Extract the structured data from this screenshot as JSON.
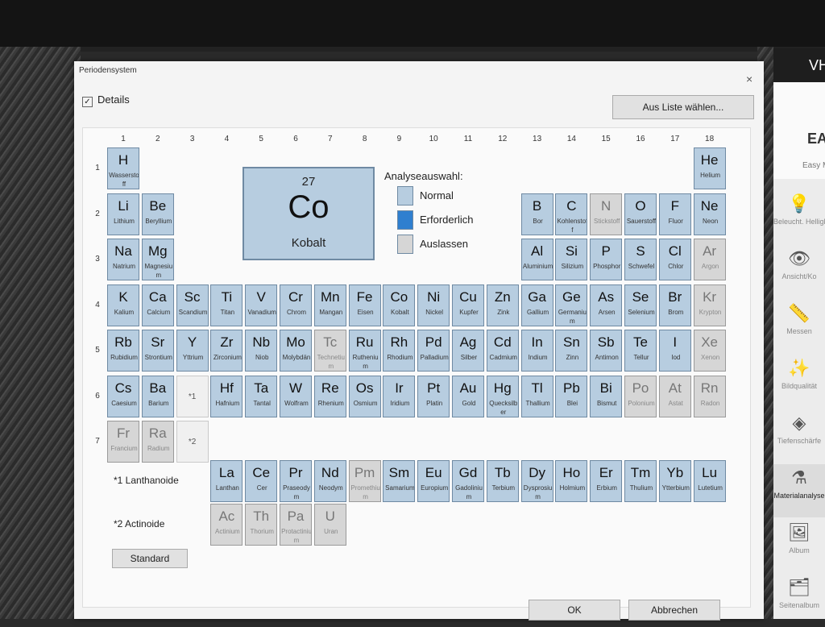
{
  "colors": {
    "normal": "#b7cde0",
    "required": "#2f7fcf",
    "skip": "#d6d6d6"
  },
  "app": {
    "header_text": "VH",
    "brand": "EAS",
    "brand_sub": "Easy M",
    "sidebar": [
      {
        "name": "beleuchtung",
        "icon": "bulb-icon",
        "glyph": "💡",
        "label": "Beleucht. Helligk.",
        "active": false
      },
      {
        "name": "ansicht",
        "icon": "view-icon",
        "glyph": "👁",
        "label": "Ansicht/Ko",
        "active": false
      },
      {
        "name": "messen",
        "icon": "ruler-icon",
        "glyph": "📏",
        "label": "Messen",
        "active": false
      },
      {
        "name": "bildqualitaet",
        "icon": "wand-icon",
        "glyph": "✨",
        "label": "Bildqualität",
        "active": false
      },
      {
        "name": "tiefenschaerfe",
        "icon": "layers-icon",
        "glyph": "◈",
        "label": "Tiefenschärfe",
        "active": false
      },
      {
        "name": "materialanalyse",
        "icon": "flask-icon",
        "glyph": "⚗",
        "label": "Materialanalyse",
        "active": true
      },
      {
        "name": "album",
        "icon": "album-icon",
        "glyph": "🖼",
        "label": "Album",
        "active": false
      },
      {
        "name": "seitenalbum",
        "icon": "page-album-icon",
        "glyph": "🗂",
        "label": "Seitenalbum",
        "active": false
      }
    ]
  },
  "dialog": {
    "title": "Periodensystem",
    "close": "×",
    "details_label": "Details",
    "details_checked": "✓",
    "choose_from_list": "Aus Liste wählen...",
    "standard": "Standard",
    "ok": "OK",
    "cancel": "Abbrechen"
  },
  "selected": {
    "number": "27",
    "symbol": "Co",
    "name": "Kobalt"
  },
  "legend": {
    "title": "Analyseauswahl:",
    "items": [
      {
        "label": "Normal",
        "state": "normal"
      },
      {
        "label": "Erforderlich",
        "state": "required"
      },
      {
        "label": "Auslassen",
        "state": "skip"
      }
    ]
  },
  "groups": [
    "1",
    "2",
    "3",
    "4",
    "5",
    "6",
    "7",
    "8",
    "9",
    "10",
    "11",
    "12",
    "13",
    "14",
    "15",
    "16",
    "17",
    "18"
  ],
  "periods": [
    "1",
    "2",
    "3",
    "4",
    "5",
    "6",
    "7"
  ],
  "placeholders": [
    {
      "text": "*1",
      "col": 3,
      "row": 6
    },
    {
      "text": "*2",
      "col": 3,
      "row": 7
    }
  ],
  "series_labels": {
    "lanthanides": "*1 Lanthanoide",
    "actinides": "*2 Actinoide"
  },
  "elements": [
    {
      "s": "H",
      "n": "Wasserstoff",
      "c": 1,
      "r": 1,
      "st": "normal"
    },
    {
      "s": "He",
      "n": "Helium",
      "c": 18,
      "r": 1,
      "st": "normal"
    },
    {
      "s": "Li",
      "n": "Lithium",
      "c": 1,
      "r": 2,
      "st": "normal"
    },
    {
      "s": "Be",
      "n": "Beryllium",
      "c": 2,
      "r": 2,
      "st": "normal"
    },
    {
      "s": "B",
      "n": "Bor",
      "c": 13,
      "r": 2,
      "st": "normal"
    },
    {
      "s": "C",
      "n": "Kohlenstoff",
      "c": 14,
      "r": 2,
      "st": "normal"
    },
    {
      "s": "N",
      "n": "Stickstoff",
      "c": 15,
      "r": 2,
      "st": "skip"
    },
    {
      "s": "O",
      "n": "Sauerstoff",
      "c": 16,
      "r": 2,
      "st": "normal"
    },
    {
      "s": "F",
      "n": "Fluor",
      "c": 17,
      "r": 2,
      "st": "normal"
    },
    {
      "s": "Ne",
      "n": "Neon",
      "c": 18,
      "r": 2,
      "st": "normal"
    },
    {
      "s": "Na",
      "n": "Natrium",
      "c": 1,
      "r": 3,
      "st": "normal"
    },
    {
      "s": "Mg",
      "n": "Magnesium",
      "c": 2,
      "r": 3,
      "st": "normal"
    },
    {
      "s": "Al",
      "n": "Aluminium",
      "c": 13,
      "r": 3,
      "st": "normal"
    },
    {
      "s": "Si",
      "n": "Silizium",
      "c": 14,
      "r": 3,
      "st": "normal"
    },
    {
      "s": "P",
      "n": "Phosphor",
      "c": 15,
      "r": 3,
      "st": "normal"
    },
    {
      "s": "S",
      "n": "Schwefel",
      "c": 16,
      "r": 3,
      "st": "normal"
    },
    {
      "s": "Cl",
      "n": "Chlor",
      "c": 17,
      "r": 3,
      "st": "normal"
    },
    {
      "s": "Ar",
      "n": "Argon",
      "c": 18,
      "r": 3,
      "st": "skip"
    },
    {
      "s": "K",
      "n": "Kalium",
      "c": 1,
      "r": 4,
      "st": "normal"
    },
    {
      "s": "Ca",
      "n": "Calcium",
      "c": 2,
      "r": 4,
      "st": "normal"
    },
    {
      "s": "Sc",
      "n": "Scandium",
      "c": 3,
      "r": 4,
      "st": "normal"
    },
    {
      "s": "Ti",
      "n": "Titan",
      "c": 4,
      "r": 4,
      "st": "normal"
    },
    {
      "s": "V",
      "n": "Vanadium",
      "c": 5,
      "r": 4,
      "st": "normal"
    },
    {
      "s": "Cr",
      "n": "Chrom",
      "c": 6,
      "r": 4,
      "st": "normal"
    },
    {
      "s": "Mn",
      "n": "Mangan",
      "c": 7,
      "r": 4,
      "st": "normal"
    },
    {
      "s": "Fe",
      "n": "Eisen",
      "c": 8,
      "r": 4,
      "st": "normal"
    },
    {
      "s": "Co",
      "n": "Kobalt",
      "c": 9,
      "r": 4,
      "st": "normal"
    },
    {
      "s": "Ni",
      "n": "Nickel",
      "c": 10,
      "r": 4,
      "st": "normal"
    },
    {
      "s": "Cu",
      "n": "Kupfer",
      "c": 11,
      "r": 4,
      "st": "normal"
    },
    {
      "s": "Zn",
      "n": "Zink",
      "c": 12,
      "r": 4,
      "st": "normal"
    },
    {
      "s": "Ga",
      "n": "Gallium",
      "c": 13,
      "r": 4,
      "st": "normal"
    },
    {
      "s": "Ge",
      "n": "Germanium",
      "c": 14,
      "r": 4,
      "st": "normal"
    },
    {
      "s": "As",
      "n": "Arsen",
      "c": 15,
      "r": 4,
      "st": "normal"
    },
    {
      "s": "Se",
      "n": "Selenium",
      "c": 16,
      "r": 4,
      "st": "normal"
    },
    {
      "s": "Br",
      "n": "Brom",
      "c": 17,
      "r": 4,
      "st": "normal"
    },
    {
      "s": "Kr",
      "n": "Krypton",
      "c": 18,
      "r": 4,
      "st": "skip"
    },
    {
      "s": "Rb",
      "n": "Rubidium",
      "c": 1,
      "r": 5,
      "st": "normal"
    },
    {
      "s": "Sr",
      "n": "Strontium",
      "c": 2,
      "r": 5,
      "st": "normal"
    },
    {
      "s": "Y",
      "n": "Yttrium",
      "c": 3,
      "r": 5,
      "st": "normal"
    },
    {
      "s": "Zr",
      "n": "Zirconium",
      "c": 4,
      "r": 5,
      "st": "normal"
    },
    {
      "s": "Nb",
      "n": "Niob",
      "c": 5,
      "r": 5,
      "st": "normal"
    },
    {
      "s": "Mo",
      "n": "Molybdän",
      "c": 6,
      "r": 5,
      "st": "normal"
    },
    {
      "s": "Tc",
      "n": "Technetium",
      "c": 7,
      "r": 5,
      "st": "skip"
    },
    {
      "s": "Ru",
      "n": "Ruthenium",
      "c": 8,
      "r": 5,
      "st": "normal"
    },
    {
      "s": "Rh",
      "n": "Rhodium",
      "c": 9,
      "r": 5,
      "st": "normal"
    },
    {
      "s": "Pd",
      "n": "Palladium",
      "c": 10,
      "r": 5,
      "st": "normal"
    },
    {
      "s": "Ag",
      "n": "Silber",
      "c": 11,
      "r": 5,
      "st": "normal"
    },
    {
      "s": "Cd",
      "n": "Cadmium",
      "c": 12,
      "r": 5,
      "st": "normal"
    },
    {
      "s": "In",
      "n": "Indium",
      "c": 13,
      "r": 5,
      "st": "normal"
    },
    {
      "s": "Sn",
      "n": "Zinn",
      "c": 14,
      "r": 5,
      "st": "normal"
    },
    {
      "s": "Sb",
      "n": "Antimon",
      "c": 15,
      "r": 5,
      "st": "normal"
    },
    {
      "s": "Te",
      "n": "Tellur",
      "c": 16,
      "r": 5,
      "st": "normal"
    },
    {
      "s": "I",
      "n": "Iod",
      "c": 17,
      "r": 5,
      "st": "normal"
    },
    {
      "s": "Xe",
      "n": "Xenon",
      "c": 18,
      "r": 5,
      "st": "skip"
    },
    {
      "s": "Cs",
      "n": "Caesium",
      "c": 1,
      "r": 6,
      "st": "normal"
    },
    {
      "s": "Ba",
      "n": "Barium",
      "c": 2,
      "r": 6,
      "st": "normal"
    },
    {
      "s": "Hf",
      "n": "Hafnium",
      "c": 4,
      "r": 6,
      "st": "normal"
    },
    {
      "s": "Ta",
      "n": "Tantal",
      "c": 5,
      "r": 6,
      "st": "normal"
    },
    {
      "s": "W",
      "n": "Wolfram",
      "c": 6,
      "r": 6,
      "st": "normal"
    },
    {
      "s": "Re",
      "n": "Rhenium",
      "c": 7,
      "r": 6,
      "st": "normal"
    },
    {
      "s": "Os",
      "n": "Osmium",
      "c": 8,
      "r": 6,
      "st": "normal"
    },
    {
      "s": "Ir",
      "n": "Iridium",
      "c": 9,
      "r": 6,
      "st": "normal"
    },
    {
      "s": "Pt",
      "n": "Platin",
      "c": 10,
      "r": 6,
      "st": "normal"
    },
    {
      "s": "Au",
      "n": "Gold",
      "c": 11,
      "r": 6,
      "st": "normal"
    },
    {
      "s": "Hg",
      "n": "Quecksilber",
      "c": 12,
      "r": 6,
      "st": "normal"
    },
    {
      "s": "Tl",
      "n": "Thallium",
      "c": 13,
      "r": 6,
      "st": "normal"
    },
    {
      "s": "Pb",
      "n": "Blei",
      "c": 14,
      "r": 6,
      "st": "normal"
    },
    {
      "s": "Bi",
      "n": "Bismut",
      "c": 15,
      "r": 6,
      "st": "normal"
    },
    {
      "s": "Po",
      "n": "Polonium",
      "c": 16,
      "r": 6,
      "st": "skip"
    },
    {
      "s": "At",
      "n": "Astat",
      "c": 17,
      "r": 6,
      "st": "skip"
    },
    {
      "s": "Rn",
      "n": "Radon",
      "c": 18,
      "r": 6,
      "st": "skip"
    },
    {
      "s": "Fr",
      "n": "Francium",
      "c": 1,
      "r": 7,
      "st": "skip"
    },
    {
      "s": "Ra",
      "n": "Radium",
      "c": 2,
      "r": 7,
      "st": "skip"
    }
  ],
  "lanthanides": [
    {
      "s": "La",
      "n": "Lanthan",
      "st": "normal"
    },
    {
      "s": "Ce",
      "n": "Cer",
      "st": "normal"
    },
    {
      "s": "Pr",
      "n": "Praseodym",
      "st": "normal"
    },
    {
      "s": "Nd",
      "n": "Neodym",
      "st": "normal"
    },
    {
      "s": "Pm",
      "n": "Promethium",
      "st": "skip"
    },
    {
      "s": "Sm",
      "n": "Samarium",
      "st": "normal"
    },
    {
      "s": "Eu",
      "n": "Europium",
      "st": "normal"
    },
    {
      "s": "Gd",
      "n": "Gadolinium",
      "st": "normal"
    },
    {
      "s": "Tb",
      "n": "Terbium",
      "st": "normal"
    },
    {
      "s": "Dy",
      "n": "Dysprosium",
      "st": "normal"
    },
    {
      "s": "Ho",
      "n": "Holmium",
      "st": "normal"
    },
    {
      "s": "Er",
      "n": "Erbium",
      "st": "normal"
    },
    {
      "s": "Tm",
      "n": "Thulium",
      "st": "normal"
    },
    {
      "s": "Yb",
      "n": "Ytterbium",
      "st": "normal"
    },
    {
      "s": "Lu",
      "n": "Lutetium",
      "st": "normal"
    }
  ],
  "actinides": [
    {
      "s": "Ac",
      "n": "Actinium",
      "st": "skip"
    },
    {
      "s": "Th",
      "n": "Thorium",
      "st": "skip"
    },
    {
      "s": "Pa",
      "n": "Protactinium",
      "st": "skip"
    },
    {
      "s": "U",
      "n": "Uran",
      "st": "skip"
    }
  ]
}
